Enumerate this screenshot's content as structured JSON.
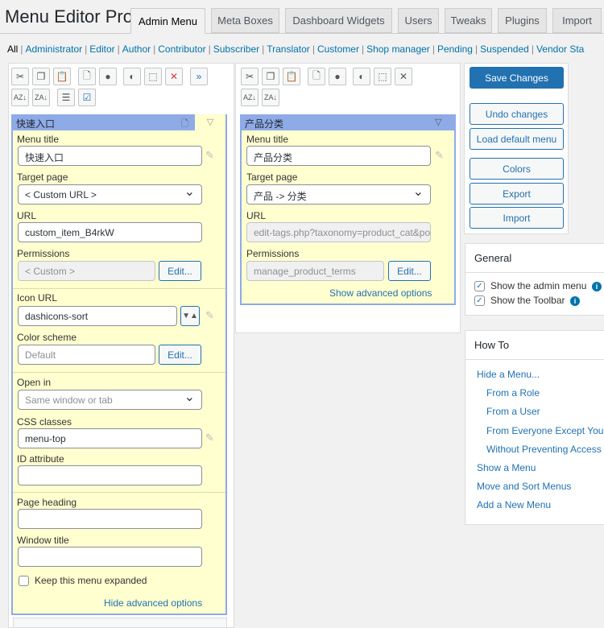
{
  "title": "Menu Editor Pro",
  "tabs": [
    "Admin Menu",
    "Meta Boxes",
    "Dashboard Widgets",
    "Users",
    "Tweaks",
    "Plugins",
    "Import"
  ],
  "roles": [
    "All",
    "Administrator",
    "Editor",
    "Author",
    "Contributor",
    "Subscriber",
    "Translator",
    "Customer",
    "Shop manager",
    "Pending",
    "Suspended",
    "Vendor Sta"
  ],
  "left_item": {
    "header": "快速入口",
    "menu_title_label": "Menu title",
    "menu_title": "快速入口",
    "target_label": "Target page",
    "target": "< Custom URL >",
    "url_label": "URL",
    "url": "custom_item_B4rkW",
    "perm_label": "Permissions",
    "perm": "< Custom >",
    "edit": "Edit...",
    "icon_label": "Icon URL",
    "icon": "dashicons-sort",
    "color_label": "Color scheme",
    "color_placeholder": "Default",
    "open_label": "Open in",
    "open": "Same window or tab",
    "css_label": "CSS classes",
    "css": "menu-top",
    "id_label": "ID attribute",
    "heading_label": "Page heading",
    "window_label": "Window title",
    "keep_label": "Keep this menu expanded",
    "hide_adv": "Hide advanced options"
  },
  "mid_item": {
    "header": "产品分类",
    "menu_title_label": "Menu title",
    "menu_title": "产品分类",
    "target_label": "Target page",
    "target": "产品 -> 分类",
    "url_label": "URL",
    "url": "edit-tags.php?taxonomy=product_cat&post_type=product",
    "perm_label": "Permissions",
    "perm": "manage_product_terms",
    "edit": "Edit...",
    "show_adv": "Show advanced options"
  },
  "actions": {
    "save": "Save Changes",
    "undo": "Undo changes",
    "load_default": "Load default menu",
    "colors": "Colors",
    "export": "Export",
    "import": "Import"
  },
  "general": {
    "title": "General",
    "show_admin_menu": "Show the admin menu",
    "show_toolbar": "Show the Toolbar"
  },
  "howto": {
    "title": "How To",
    "links": [
      "Hide a Menu...",
      "From a Role",
      "From a User",
      "From Everyone Except You",
      "Without Preventing Access",
      "Show a Menu",
      "Move and Sort Menus",
      "Add a New Menu"
    ]
  },
  "colors": {
    "accent": "#2271b1",
    "item_header": "#8eabe8",
    "item_body": "#ffffd0"
  }
}
